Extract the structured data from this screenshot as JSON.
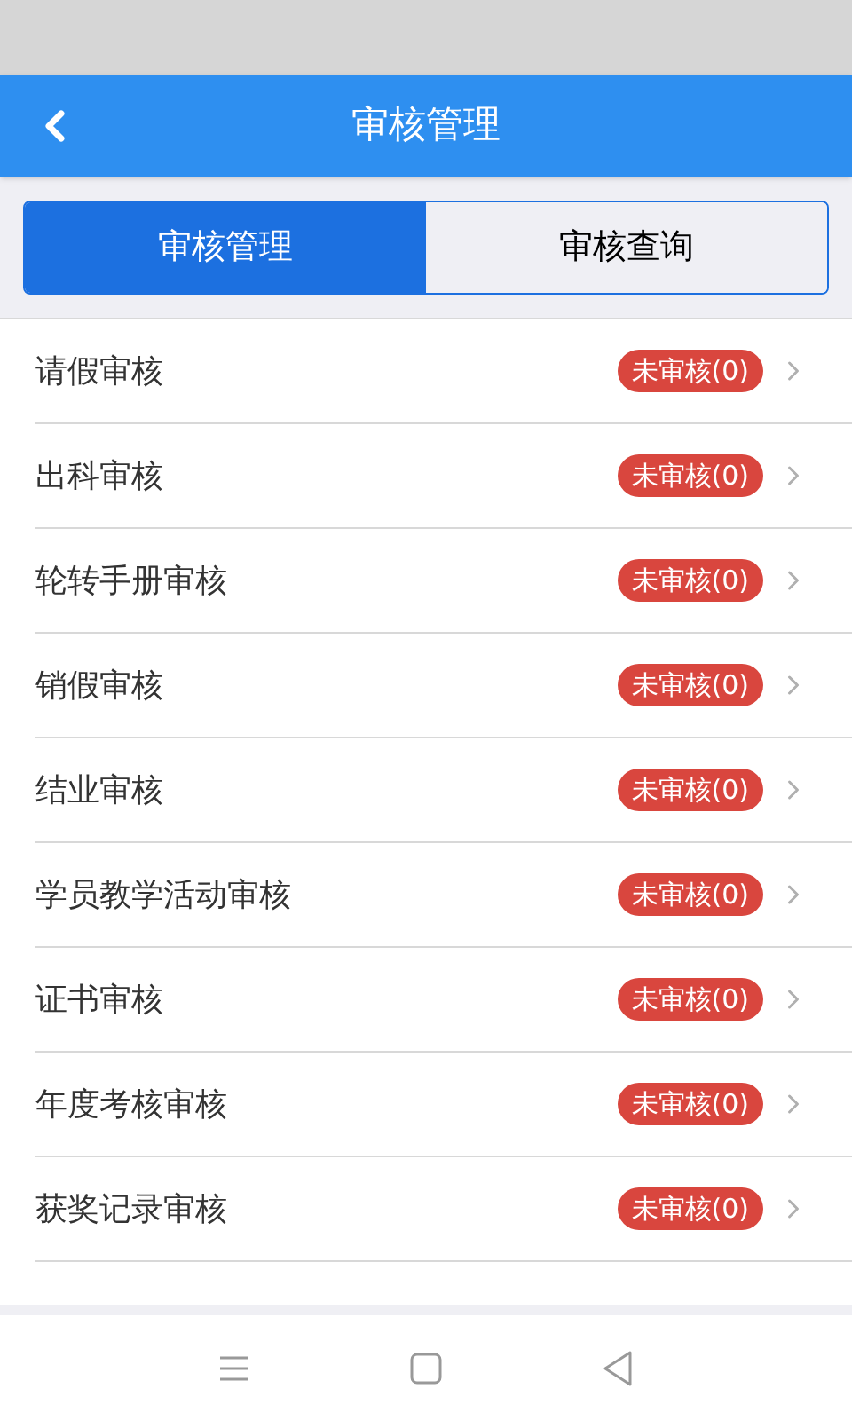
{
  "header": {
    "title": "审核管理"
  },
  "tabs": [
    {
      "label": "审核管理",
      "selected": true
    },
    {
      "label": "审核查询",
      "selected": false
    }
  ],
  "items": [
    {
      "label": "请假审核",
      "badge": "未审核(0)"
    },
    {
      "label": "出科审核",
      "badge": "未审核(0)"
    },
    {
      "label": "轮转手册审核",
      "badge": "未审核(0)"
    },
    {
      "label": "销假审核",
      "badge": "未审核(0)"
    },
    {
      "label": "结业审核",
      "badge": "未审核(0)"
    },
    {
      "label": "学员教学活动审核",
      "badge": "未审核(0)"
    },
    {
      "label": "证书审核",
      "badge": "未审核(0)"
    },
    {
      "label": "年度考核审核",
      "badge": "未审核(0)"
    },
    {
      "label": "获奖记录审核",
      "badge": "未审核(0)"
    }
  ]
}
